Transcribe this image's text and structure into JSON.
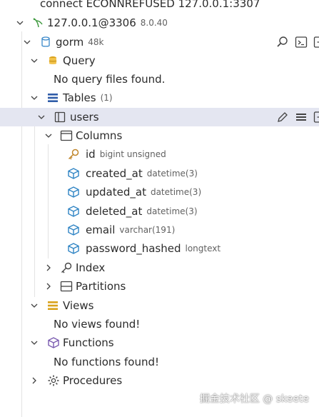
{
  "tree": {
    "error_line": "connect ECONNREFUSED 127.0.0.1:3307",
    "connection": {
      "name": "127.0.0.1@3306",
      "version": "8.0.40"
    },
    "database": {
      "name": "gorm",
      "size": "48k"
    },
    "query": {
      "label": "Query",
      "empty": "No query files found."
    },
    "tables": {
      "label": "Tables",
      "count": "(1)"
    },
    "table": {
      "name": "users"
    },
    "columns_label": "Columns",
    "columns": [
      {
        "name": "id",
        "type": "bigint unsigned",
        "icon": "key-icon"
      },
      {
        "name": "created_at",
        "type": "datetime(3)",
        "icon": "cube-icon"
      },
      {
        "name": "updated_at",
        "type": "datetime(3)",
        "icon": "cube-icon"
      },
      {
        "name": "deleted_at",
        "type": "datetime(3)",
        "icon": "cube-icon"
      },
      {
        "name": "email",
        "type": "varchar(191)",
        "icon": "cube-icon"
      },
      {
        "name": "password_hashed",
        "type": "longtext",
        "icon": "cube-icon"
      }
    ],
    "index_label": "Index",
    "partitions_label": "Partitions",
    "views": {
      "label": "Views",
      "empty": "No views found!"
    },
    "functions": {
      "label": "Functions",
      "empty": "No functions found!"
    },
    "procedures": {
      "label": "Procedures"
    }
  },
  "watermark": "掘金技术社区 @ skeete",
  "colors": {
    "selection": "#e4e6f1",
    "connection_icon": "#3f9a3f",
    "database_icon": "#3a88c9",
    "query_icon": "#d9a21b",
    "tables_icon": "#2f5ca8",
    "column_icon": "#2f84c4",
    "key_icon": "#c0862c",
    "views_icon": "#d9a21b",
    "functions_icon": "#7a5bb0"
  }
}
